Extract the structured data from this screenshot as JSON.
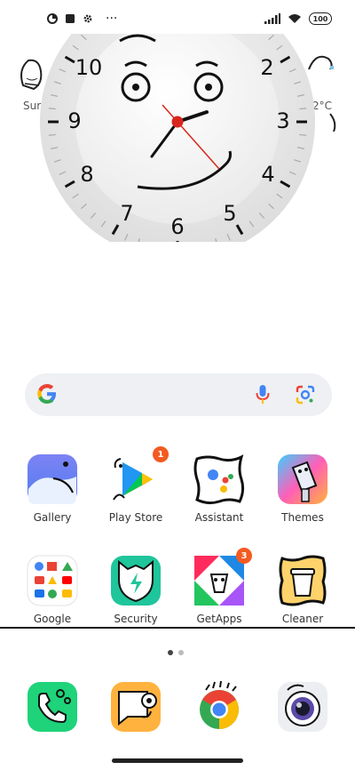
{
  "status_bar": {
    "icons_left": [
      "data-saver-icon",
      "square-stop-icon",
      "gear-icon",
      "more-dots-icon"
    ],
    "more_label": "···",
    "icons_right": [
      "signal-icon",
      "wifi-icon",
      "battery-icon"
    ],
    "battery_level": "100"
  },
  "clock_widget": {
    "numbers": [
      "10",
      "2",
      "9",
      "3",
      "8",
      "4",
      "7",
      "5",
      "6"
    ],
    "time_shown": "1:37"
  },
  "weather_widget": {
    "left_label": "Sur",
    "right_label": "2°C"
  },
  "search_bar": {
    "logo": "google-g-icon",
    "mic_icon": "microphone-icon",
    "lens_icon": "google-lens-icon"
  },
  "apps": [
    {
      "label": "Gallery",
      "icon": "gallery-icon"
    },
    {
      "label": "Play Store",
      "icon": "play-store-icon",
      "badge": "1"
    },
    {
      "label": "Assistant",
      "icon": "assistant-icon"
    },
    {
      "label": "Themes",
      "icon": "themes-icon"
    },
    {
      "label": "Google",
      "icon": "google-folder-icon"
    },
    {
      "label": "Security",
      "icon": "security-icon"
    },
    {
      "label": "GetApps",
      "icon": "getapps-icon",
      "badge": "3"
    },
    {
      "label": "Cleaner",
      "icon": "cleaner-icon"
    }
  ],
  "page_indicator": {
    "count": 2,
    "active": 0
  },
  "dock": [
    {
      "icon": "phone-icon"
    },
    {
      "icon": "messages-icon"
    },
    {
      "icon": "chrome-icon"
    },
    {
      "icon": "camera-icon"
    }
  ],
  "colors": {
    "badge": "#f35b22",
    "clock_second_hand": "#d9261c",
    "search_bg": "#eef0f3"
  }
}
